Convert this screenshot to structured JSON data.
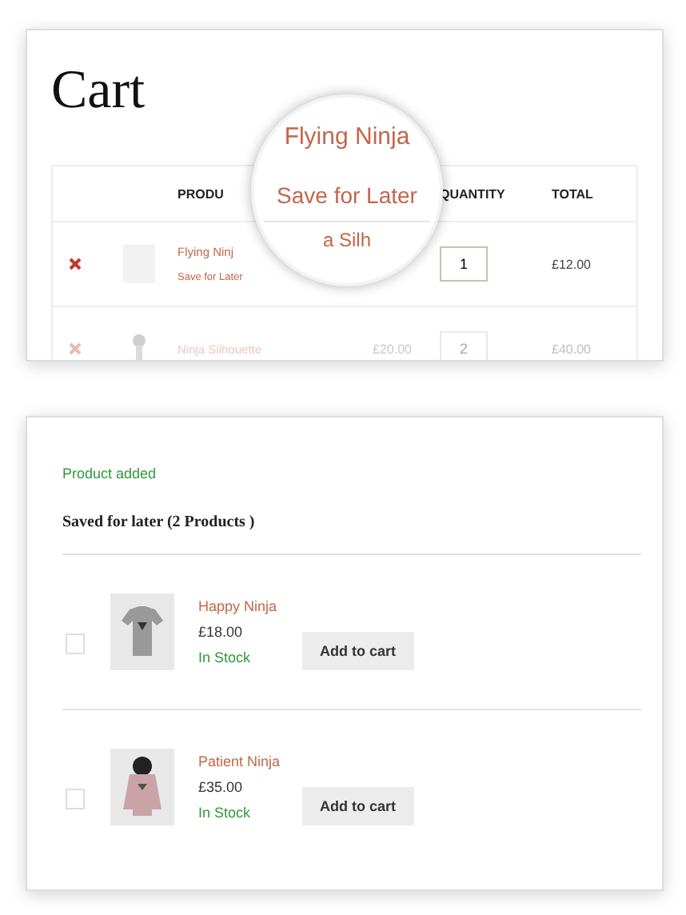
{
  "cart": {
    "title": "Cart",
    "columns": [
      "PRODU",
      "QUANTITY",
      "TOTAL"
    ],
    "rows": [
      {
        "kind": "placeholder",
        "name": "Flying Ninj",
        "link": "Save for Later",
        "quantity": "1",
        "total": "£12.00",
        "faded": false
      },
      {
        "kind": "figure",
        "name": "Ninja Silhouette",
        "price": "£20.00",
        "quantity": "2",
        "total": "£40.00",
        "faded": true
      }
    ],
    "magnifier": [
      "Flying Ninja",
      "Save for Later",
      "a Silh"
    ]
  },
  "saved": {
    "notice": "Product added",
    "heading": "Saved for later (2 Products )",
    "items": [
      {
        "kind": "tshirt",
        "checked": false,
        "name": "Happy Ninja",
        "price": "£18.00",
        "stock": "In Stock",
        "button": "Add to cart"
      },
      {
        "kind": "hoodie",
        "checked": false,
        "name": "Patient Ninja",
        "price": "£35.00",
        "stock": "In Stock",
        "button": "Add to cart"
      }
    ]
  }
}
